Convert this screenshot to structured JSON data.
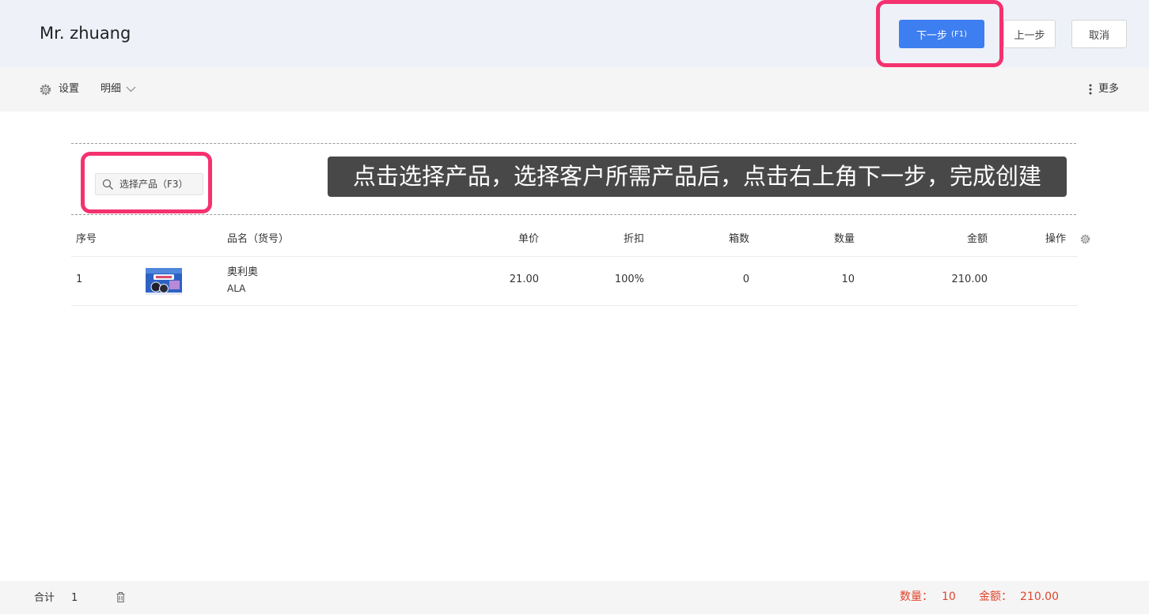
{
  "header": {
    "title": "Mr. zhuang",
    "next_label": "下一步",
    "next_shortcut": "(F1)",
    "prev_label": "上一步",
    "cancel_label": "取消"
  },
  "toolbar": {
    "settings_label": "设置",
    "detail_label": "明细",
    "more_label": "更多"
  },
  "search": {
    "placeholder": "选择产品（F3）"
  },
  "tooltip": {
    "text": "点击选择产品，选择客户所需产品后，点击右上角下一步，完成创建"
  },
  "table": {
    "columns": {
      "index": "序号",
      "name": "品名（货号）",
      "price": "单价",
      "discount": "折扣",
      "boxes": "箱数",
      "quantity": "数量",
      "amount": "金额",
      "actions": "操作"
    },
    "rows": [
      {
        "index": "1",
        "name": "奥利奥",
        "code": "ALA",
        "price": "21.00",
        "discount": "100%",
        "boxes": "0",
        "quantity": "10",
        "amount": "210.00"
      }
    ]
  },
  "footer": {
    "total_label": "合计",
    "total_count": "1",
    "quantity_label": "数量：",
    "quantity_value": "10",
    "amount_label": "金额：",
    "amount_value": "210.00"
  },
  "icons": {
    "settings": "gear-icon",
    "detail_toggle": "chevron-down-icon",
    "more": "vertical-dots-icon",
    "search": "search-icon",
    "column_settings": "gear-icon",
    "delete": "trash-icon",
    "product_image": "product-thumbnail"
  },
  "colors": {
    "accent": "#3d7ef0",
    "highlight": "#f5316f",
    "tooltip_background": "#484848",
    "summary_text": "#e0452b",
    "header_background": "#eef1f8",
    "toolbar_background": "#f5f5f5"
  }
}
